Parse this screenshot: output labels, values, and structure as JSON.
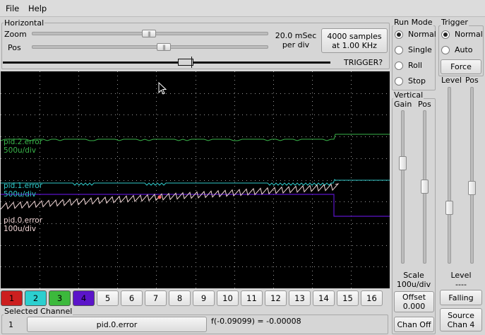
{
  "menu": {
    "file": "File",
    "help": "Help"
  },
  "horizontal": {
    "title": "Horizontal",
    "zoom_label": "Zoom",
    "pos_label": "Pos",
    "time_per_div_line1": "20.0 mSec",
    "time_per_div_line2": "per div",
    "samples_line1": "4000 samples",
    "samples_line2": "at 1.00 KHz",
    "trigger_status": "TRIGGER?"
  },
  "traces": [
    {
      "name": "pid.2.error",
      "scale": "500u/div",
      "color": "#39b54a"
    },
    {
      "name": "pid.1.error",
      "scale": "500u/div",
      "color": "#2fc8c8"
    },
    {
      "name": "pid.0.error",
      "scale": "100u/div",
      "color": "#f2d7d7"
    }
  ],
  "run_mode": {
    "title": "Run Mode",
    "options": [
      "Normal",
      "Single",
      "Roll",
      "Stop"
    ],
    "selected": "Normal"
  },
  "trigger": {
    "title": "Trigger",
    "options": [
      "Normal",
      "Auto"
    ],
    "selected": "Normal",
    "force_label": "Force",
    "level_label": "Level",
    "pos_label": "Pos",
    "level_section_label": "Level",
    "level_value": "----",
    "edge_label": "Falling",
    "source_line1": "Source",
    "source_line2": "Chan  4"
  },
  "vertical": {
    "title": "Vertical",
    "gain_label": "Gain",
    "pos_label": "Pos",
    "scale_label": "Scale",
    "scale_value": "100u/div",
    "offset_label": "Offset",
    "offset_value": "0.000",
    "chan_off_label": "Chan Off"
  },
  "channels": [
    {
      "label": "1",
      "color": "#cc1f1f"
    },
    {
      "label": "2",
      "color": "#2ccfcf"
    },
    {
      "label": "3",
      "color": "#3cb93c"
    },
    {
      "label": "4",
      "color": "#5b14c9"
    },
    {
      "label": "5",
      "color": ""
    },
    {
      "label": "6",
      "color": ""
    },
    {
      "label": "7",
      "color": ""
    },
    {
      "label": "8",
      "color": ""
    },
    {
      "label": "9",
      "color": ""
    },
    {
      "label": "10",
      "color": ""
    },
    {
      "label": "11",
      "color": ""
    },
    {
      "label": "12",
      "color": ""
    },
    {
      "label": "13",
      "color": ""
    },
    {
      "label": "14",
      "color": ""
    },
    {
      "label": "15",
      "color": ""
    },
    {
      "label": "16",
      "color": ""
    }
  ],
  "selected_channel": {
    "title": "Selected Channel",
    "number": "1",
    "name": "pid.0.error",
    "readout": "f(-0.09099) = -0.00008"
  }
}
